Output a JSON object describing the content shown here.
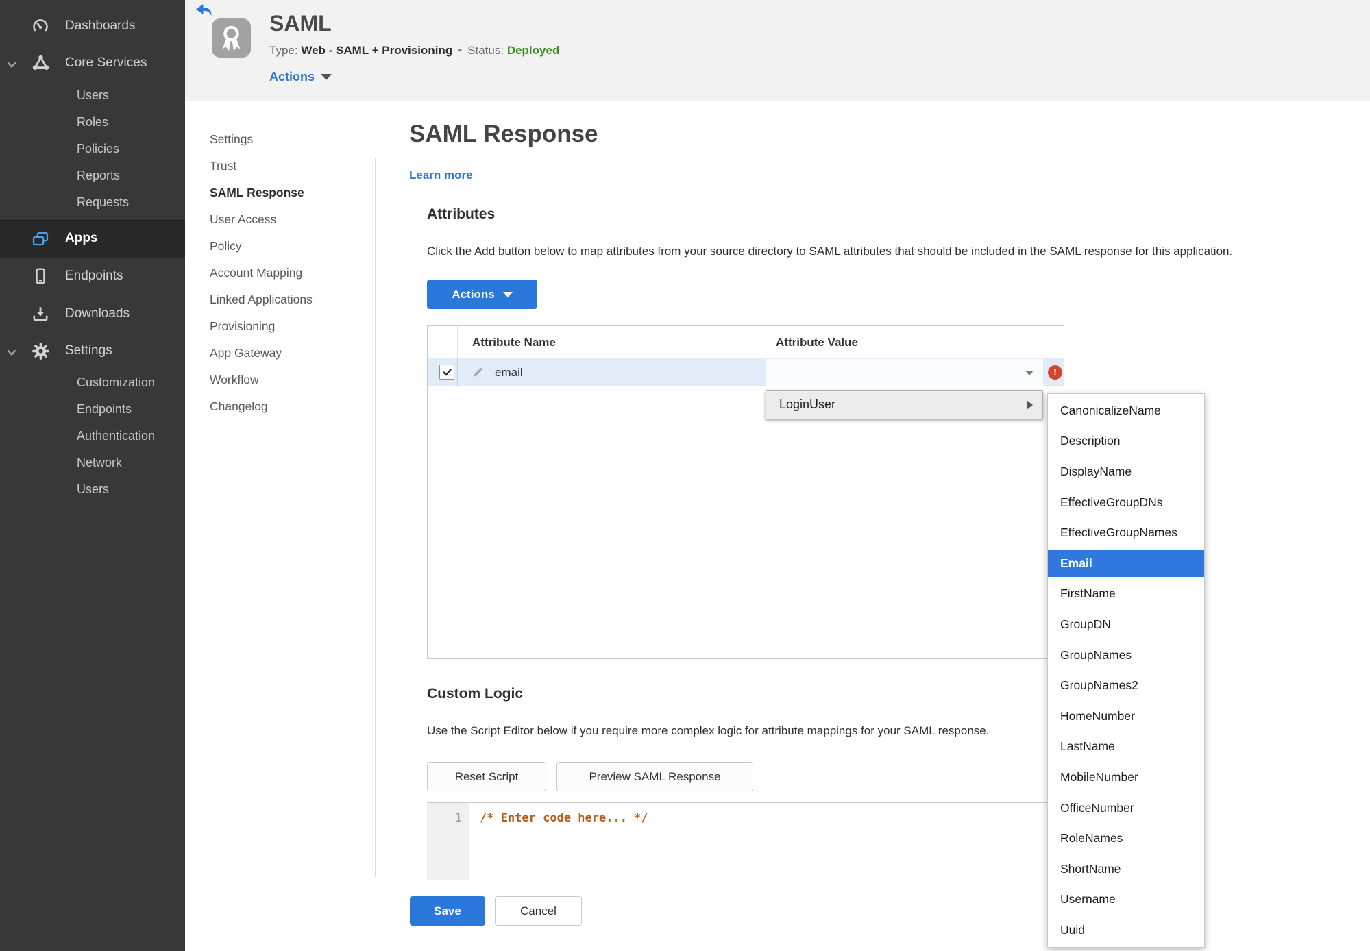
{
  "colors": {
    "accent_blue": "#2b78dd",
    "status_green": "#3e8a28",
    "error_red": "#d1452e",
    "row_selected_blue": "#e2ecf9",
    "menu_selected_blue": "#2e78de",
    "code_comment_orange": "#b5601d",
    "apps_icon_blue": "#4aa3e8",
    "sidebar_bg": "#383838"
  },
  "sidebar": {
    "dashboards": "Dashboards",
    "core_services": "Core Services",
    "core_children": [
      "Users",
      "Roles",
      "Policies",
      "Reports",
      "Requests"
    ],
    "apps": "Apps",
    "endpoints": "Endpoints",
    "downloads": "Downloads",
    "settings": "Settings",
    "settings_children": [
      "Customization",
      "Endpoints",
      "Authentication",
      "Network",
      "Users"
    ]
  },
  "header": {
    "title": "SAML",
    "type_label": "Type:",
    "type_value": "Web - SAML + Provisioning",
    "separator": "•",
    "status_label": "Status:",
    "status_value": "Deployed",
    "actions_label": "Actions"
  },
  "subnav": {
    "items": [
      "Settings",
      "Trust",
      "SAML Response",
      "User Access",
      "Policy",
      "Account Mapping",
      "Linked Applications",
      "Provisioning",
      "App Gateway",
      "Workflow",
      "Changelog"
    ],
    "active": "SAML Response"
  },
  "main": {
    "title": "SAML Response",
    "learn_more": "Learn more",
    "attributes": {
      "heading": "Attributes",
      "description": "Click the Add button below to map attributes from your source directory to SAML attributes that should be included in the SAML response for this application.",
      "actions_button": "Actions",
      "table": {
        "col_name": "Attribute Name",
        "col_value": "Attribute Value",
        "row": {
          "name": "email",
          "value": "",
          "checked": true,
          "error": "!"
        }
      }
    },
    "value_menu": {
      "parent": "LoginUser",
      "selected": "Email",
      "options": [
        "CanonicalizeName",
        "Description",
        "DisplayName",
        "EffectiveGroupDNs",
        "EffectiveGroupNames",
        "Email",
        "FirstName",
        "GroupDN",
        "GroupNames",
        "GroupNames2",
        "HomeNumber",
        "LastName",
        "MobileNumber",
        "OfficeNumber",
        "RoleNames",
        "ShortName",
        "Username",
        "Uuid"
      ]
    },
    "custom_logic": {
      "heading": "Custom Logic",
      "description": "Use the Script Editor below if you require more complex logic for attribute mappings for your SAML response.",
      "reset_button": "Reset Script",
      "preview_button": "Preview SAML Response",
      "editor": {
        "line_number": "1",
        "code": "/* Enter code here... */"
      }
    },
    "footer": {
      "save": "Save",
      "cancel": "Cancel"
    }
  }
}
